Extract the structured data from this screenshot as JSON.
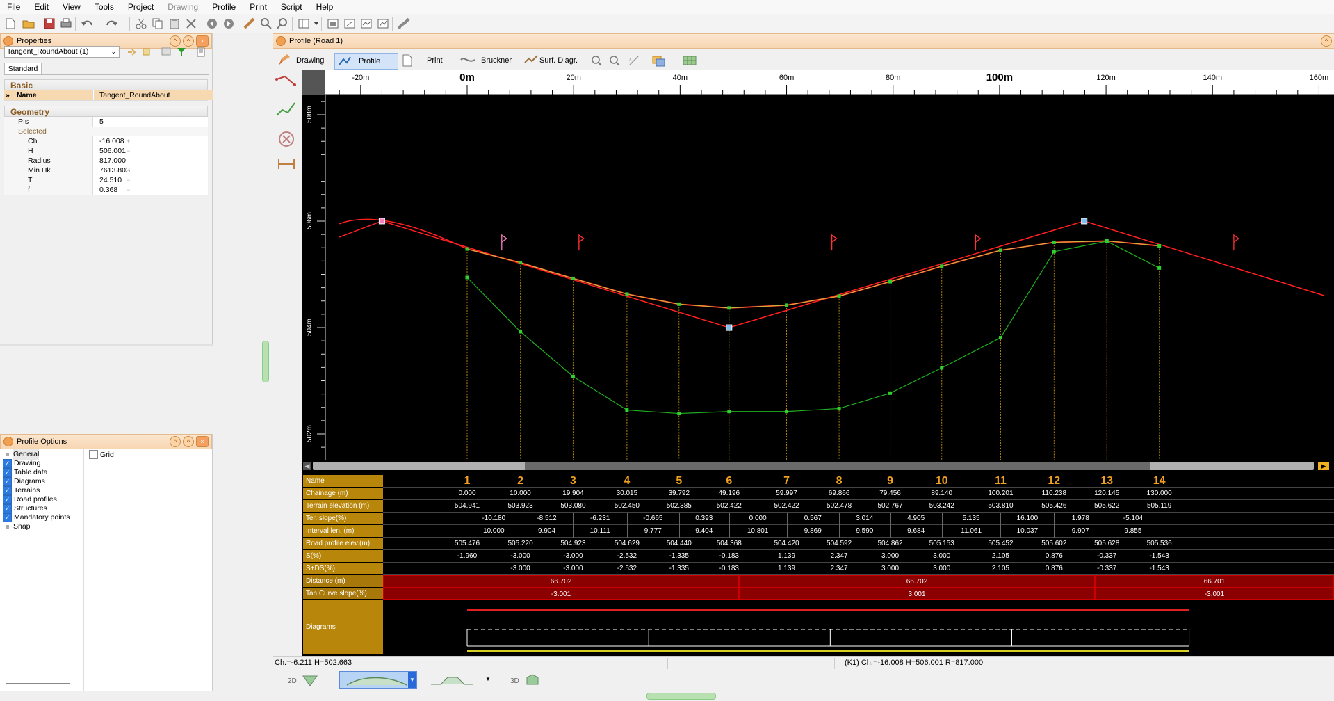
{
  "menu": [
    "File",
    "Edit",
    "View",
    "Tools",
    "Project",
    "Drawing",
    "Profile",
    "Print",
    "Script",
    "Help"
  ],
  "menu_disabled": [
    "Drawing"
  ],
  "properties": {
    "title": "Properties",
    "selector": "Tangent_RoundAbout (1)",
    "tab": "Standard",
    "basic_group": "Basic",
    "name_label": "Name",
    "name_value": "Tangent_RoundAbout",
    "geometry_group": "Geometry",
    "pis_label": "PIs",
    "pis_value": "5",
    "selected_label": "Selected",
    "rows": [
      {
        "k": "Ch.",
        "v": "-16.008"
      },
      {
        "k": "H",
        "v": "506.001"
      },
      {
        "k": "Radius",
        "v": "817.000"
      },
      {
        "k": "Min Hk",
        "v": "7613.803"
      },
      {
        "k": "T",
        "v": "24.510"
      },
      {
        "k": "f",
        "v": "0.368"
      }
    ]
  },
  "options": {
    "title": "Profile Options",
    "items": [
      "General",
      "Drawing",
      "Table data",
      "Diagrams",
      "Terrains",
      "Road profiles",
      "Structures",
      "Mandatory points",
      "Snap"
    ],
    "grid_label": "Grid"
  },
  "profile": {
    "title": "Profile (Road 1)",
    "tabs": [
      "Drawing",
      "Profile",
      "Print",
      "Bruckner",
      "Surf. Diagr."
    ],
    "active_tab": "Profile",
    "ruler": [
      "-20m",
      "0m",
      "20m",
      "40m",
      "60m",
      "80m",
      "100m",
      "120m",
      "140m",
      "160m"
    ],
    "yaxis": [
      "508m",
      "506m",
      "504m",
      "502m"
    ],
    "stations": [
      "1",
      "2",
      "3",
      "4",
      "5",
      "6",
      "7",
      "8",
      "9",
      "10",
      "11",
      "12",
      "13",
      "14"
    ],
    "table": {
      "labels": [
        "Name",
        "Chainage (m)",
        "Terrain elevation (m)",
        "Ter. slope(%)",
        "Interval len. (m)",
        "Road profile elev.(m)",
        "S(%)",
        "S+DS(%)",
        "Distance (m)",
        "Tan.Curve slope(%)",
        "Diagrams"
      ],
      "chainage": [
        "0.000",
        "10.000",
        "19.904",
        "30.015",
        "39.792",
        "49.196",
        "59.997",
        "69.866",
        "79.456",
        "89.140",
        "100.201",
        "110.238",
        "120.145",
        "130.000"
      ],
      "terrain": [
        "504.941",
        "503.923",
        "503.080",
        "502.450",
        "502.385",
        "502.422",
        "502.422",
        "502.478",
        "502.767",
        "503.242",
        "503.810",
        "505.426",
        "505.622",
        "505.119"
      ],
      "ter_slope": [
        "-10.180",
        "-8.512",
        "-6.231",
        "-0.665",
        "0.393",
        "0.000",
        "0.567",
        "3.014",
        "4.905",
        "5.135",
        "16.100",
        "1.978",
        "-5.104"
      ],
      "interval": [
        "10.000",
        "9.904",
        "10.111",
        "9.777",
        "9.404",
        "10.801",
        "9.869",
        "9.590",
        "9.684",
        "11.061",
        "10.037",
        "9.907",
        "9.855"
      ],
      "road_elev": [
        "505.476",
        "505.220",
        "504.923",
        "504.629",
        "504.440",
        "504.368",
        "504.420",
        "504.592",
        "504.862",
        "505.153",
        "505.452",
        "505.602",
        "505.628",
        "505.536"
      ],
      "s": [
        "-1.960",
        "-3.000",
        "-3.000",
        "-2.532",
        "-1.335",
        "-0.183",
        "1.139",
        "2.347",
        "3.000",
        "3.000",
        "2.105",
        "0.876",
        "-0.337",
        "-1.543"
      ],
      "sds": [
        "-3.000",
        "-3.000",
        "-2.532",
        "-1.335",
        "-0.183",
        "1.139",
        "2.347",
        "3.000",
        "3.000",
        "2.105",
        "0.876",
        "-0.337",
        "-1.543"
      ],
      "distance": [
        "66.702",
        "66.702",
        "66.701"
      ],
      "tan_slope": [
        "-3.001",
        "3.001",
        "-3.001"
      ]
    }
  },
  "status": {
    "left": "Ch.=-6.211  H=502.663",
    "right": "(K1)  Ch.=-16.008  H=506.001  R=817.000"
  },
  "bottom_modes": [
    "2D",
    "3D"
  ],
  "colors": {
    "accent": "#f0a050",
    "table_bg": "#000000",
    "label_bg": "#b8860b",
    "road": "#ff2020",
    "terrain": "#20b020"
  }
}
